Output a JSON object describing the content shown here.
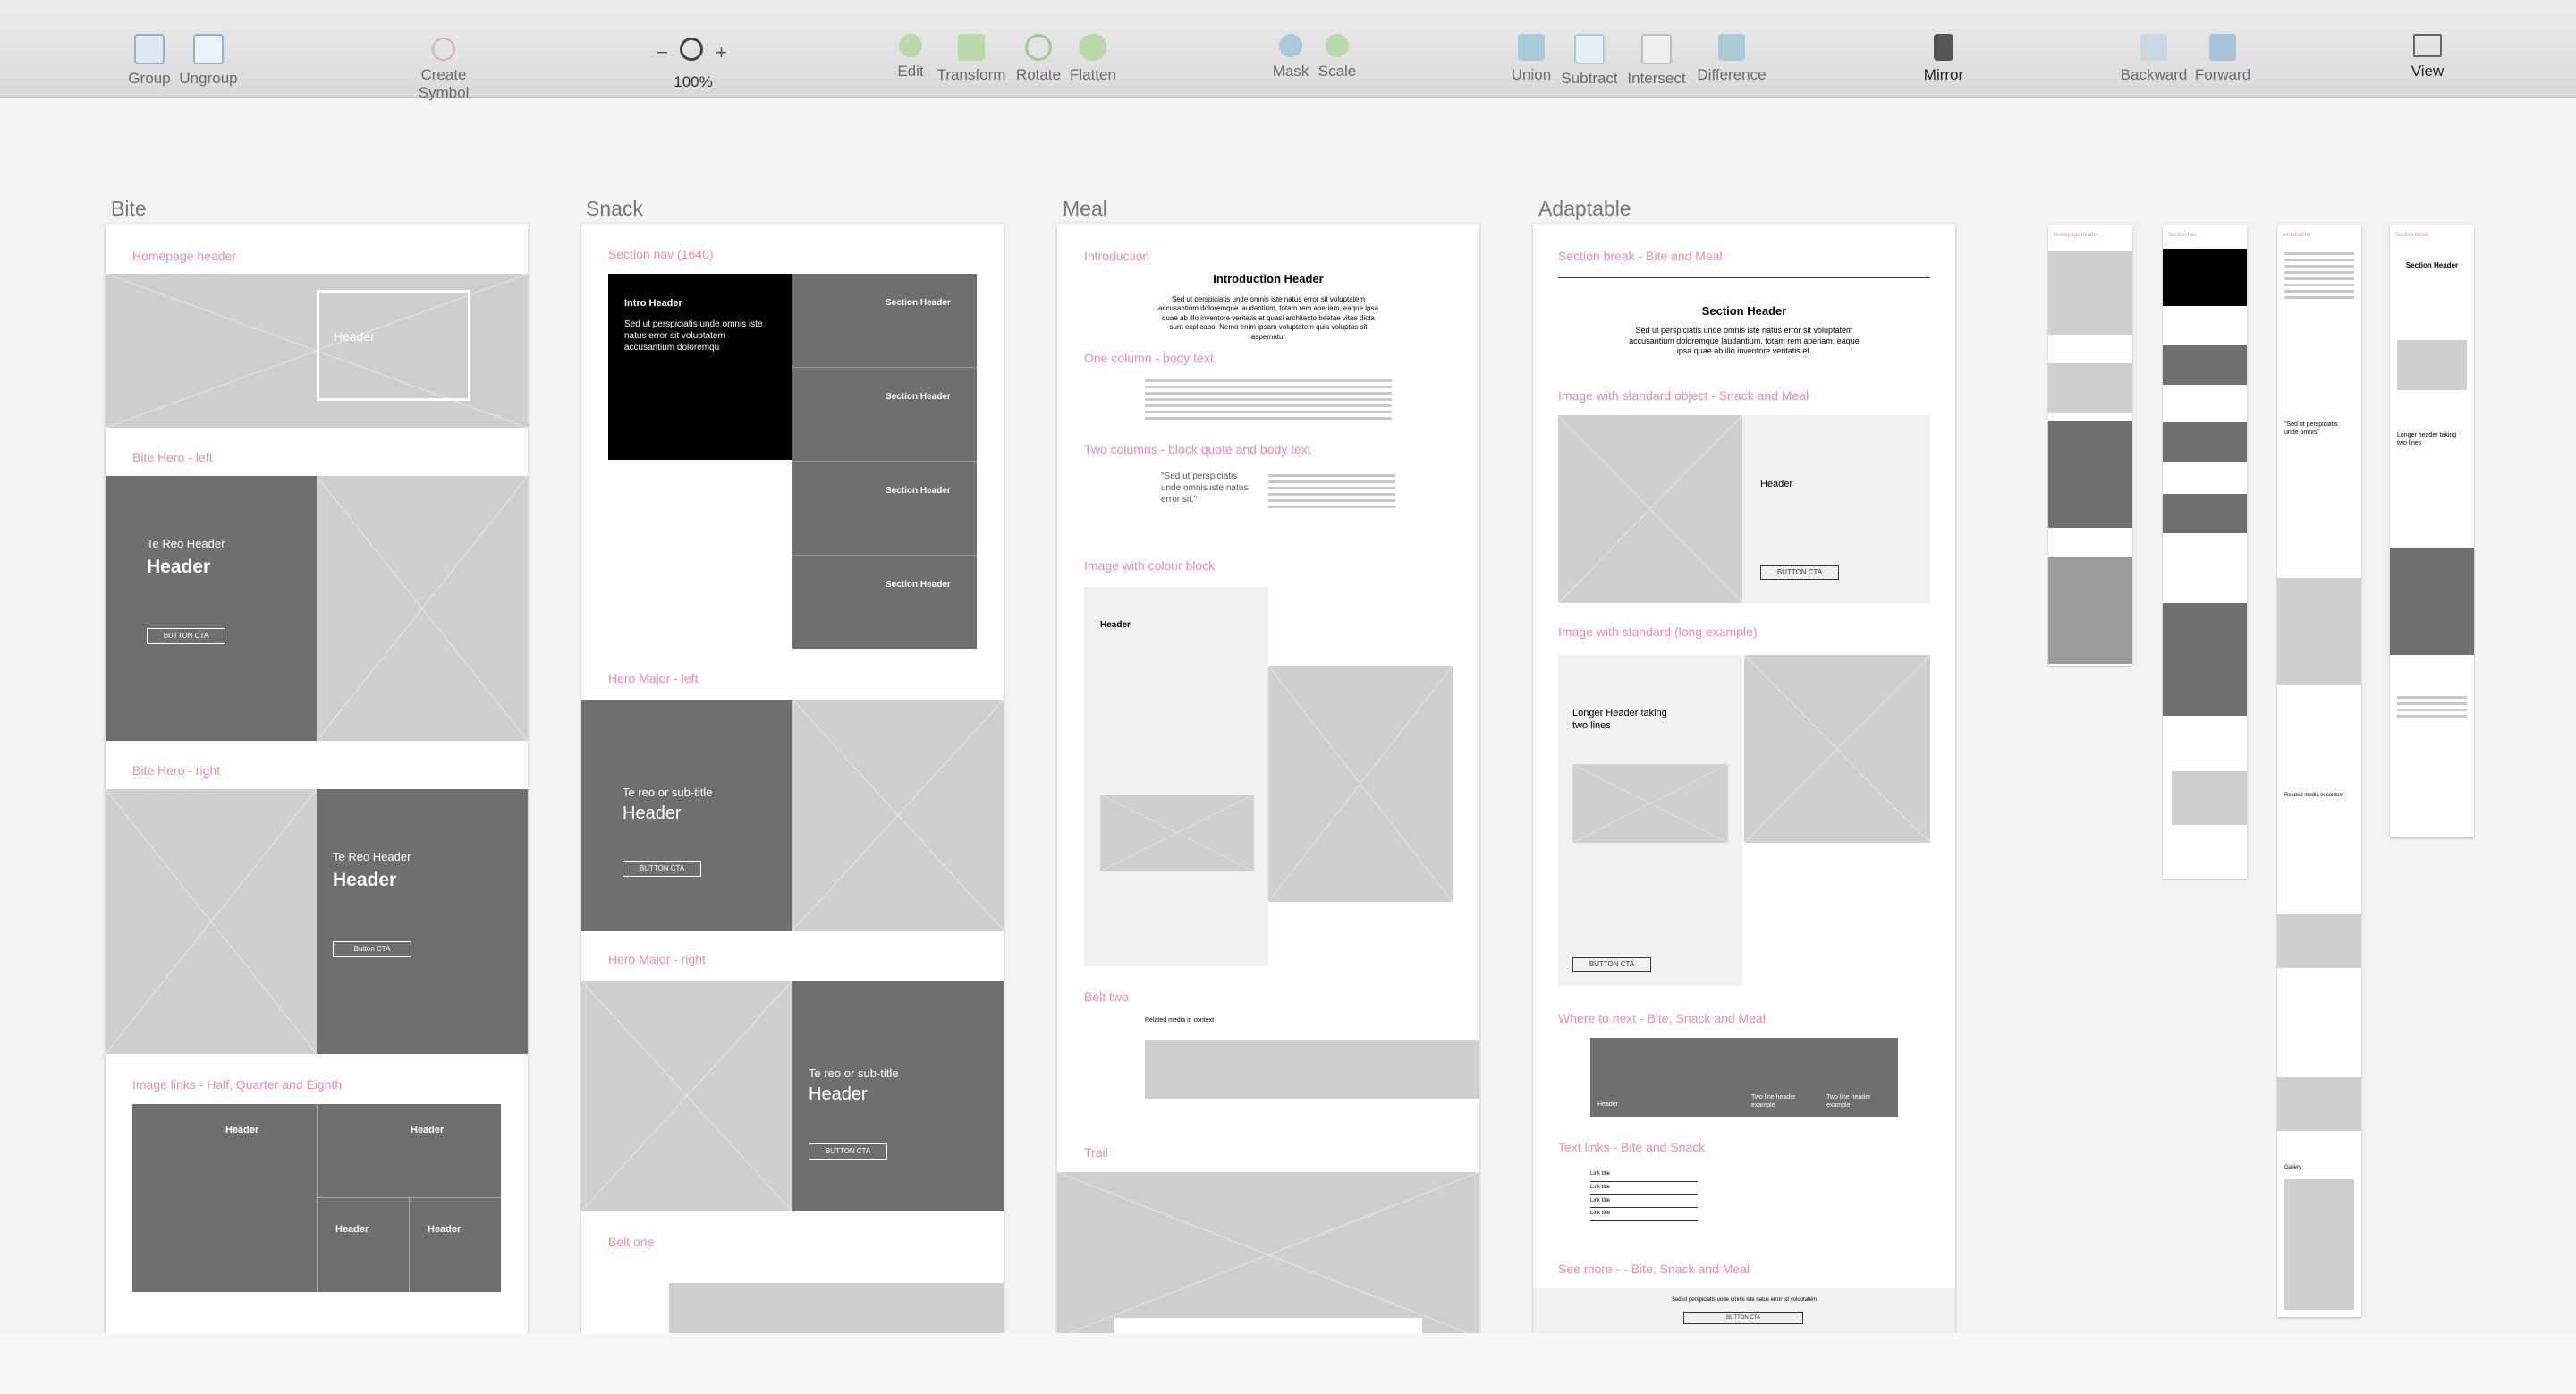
{
  "toolbar": {
    "group": "Group",
    "ungroup": "Ungroup",
    "create_symbol": "Create Symbol",
    "zoom_minus": "−",
    "zoom_plus": "+",
    "zoom_level": "100%",
    "edit": "Edit",
    "transform": "Transform",
    "rotate": "Rotate",
    "flatten": "Flatten",
    "mask": "Mask",
    "scale": "Scale",
    "union": "Union",
    "subtract": "Subtract",
    "intersect": "Intersect",
    "difference": "Difference",
    "mirror": "Mirror",
    "backward": "Backward",
    "forward": "Forward",
    "view": "View"
  },
  "boards": {
    "bite": {
      "title": "Bite",
      "homepage_header": "Homepage header",
      "hero_left": "Bite Hero - left",
      "hero_right": "Bite Hero - right",
      "image_links": "Image links - Half, Quarter and Eighth",
      "header": "Header",
      "te_reo_header": "Te Reo Header",
      "button_cta": "BUTTON CTA",
      "button_cta2": "Button CTA"
    },
    "snack": {
      "title": "Snack",
      "section_nav": "Section nav (1640)",
      "intro_header": "Intro Header",
      "intro_body": "Sed ut perspiciatis unde omnis iste natus error sit voluptatem accusantium doloremqu",
      "section_header": "Section Header",
      "hero_major_left": "Hero Major - left",
      "hero_major_right": "Hero Major - right",
      "te_reo_sub": "Te reo or sub-title",
      "header": "Header",
      "button_cta": "BUTTON CTA",
      "belt_one": "Belt one"
    },
    "meal": {
      "title": "Meal",
      "introduction": "Introduction",
      "intro_header": "Introduction Header",
      "intro_body": "Sed ut perspiciatis unde omnis iste natus error sit voluptatem accusantium doloremque laudantium, totam rem aperiam, eaque ipsa quae ab illo inventore veritatis et quasi architecto beatae vitae dicta sunt explicabo. Nemo enim ipsam voluptatem quia voluptas sit aspernatur",
      "one_column": "One column - body text",
      "two_columns": "Two columns - block quote and body text",
      "quote": "\"Sed ut perspiciatis unde omnis iste natus error sit.\"",
      "image_colour": "Image with colour block",
      "header": "Header",
      "belt_two": "Belt two",
      "related": "Related media in context",
      "trail": "Trail"
    },
    "adaptable": {
      "title": "Adaptable",
      "section_break": "Section break - Bite and Meal",
      "section_header": "Section Header",
      "section_body": "Sed ut perspiciatis unde omnis iste natus error sit voluptatem accusantium doloremque laudantium, totam rem aperiam, eaque ipsa quae ab illo inventore veritatis et.",
      "std_object": "Image with standard object - Snack and Meal",
      "header": "Header",
      "button_cta": "BUTTON CTA",
      "std_long": "Image with standard (long example)",
      "longer_header": "Longer Header taking two lines",
      "where_next": "Where to next - Bite, Snack and Meal",
      "two_line": "Two line header example",
      "text_links": "Text links - Bite and Snack",
      "link_title": "Link title",
      "see_more": "See more - - Bite, Snack and Meal",
      "see_more_body": "Sed ut perspiciatis unde omnis iste natus error sit voluptatem"
    },
    "mobile": {
      "homepage_header": "Homepage header",
      "section_nav": "Section nav",
      "introduction": "Introduction",
      "section_break": "Section break",
      "section_header": "Section Header",
      "header": "Header",
      "longer_header": "Longer header taking two lines",
      "quote": "\"Sed ut perspiciatis unde omnis\"",
      "related": "Related media in context",
      "gallery": "Gallery"
    }
  }
}
